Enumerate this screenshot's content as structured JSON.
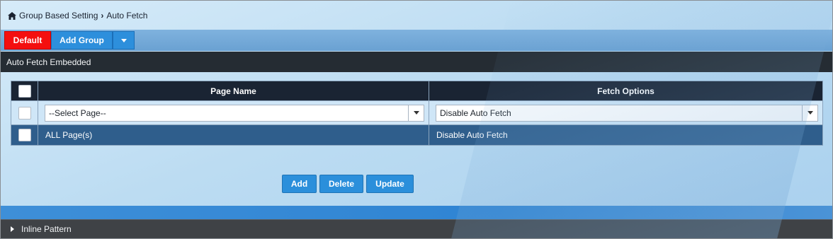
{
  "breadcrumb": {
    "items": [
      "Group Based Setting",
      "Auto Fetch"
    ]
  },
  "toolbar": {
    "default_label": "Default",
    "add_group_label": "Add Group"
  },
  "section": {
    "title": "Auto Fetch Embedded"
  },
  "table": {
    "headers": [
      "Page Name",
      "Fetch Options"
    ],
    "input_row": {
      "page_select": "--Select Page--",
      "fetch_select": "Disable Auto Fetch"
    },
    "rows": [
      {
        "page": "ALL Page(s)",
        "fetch": "Disable Auto Fetch"
      }
    ]
  },
  "actions": {
    "add": "Add",
    "delete": "Delete",
    "update": "Update"
  },
  "collapsed_section": {
    "title": "Inline Pattern"
  },
  "colors": {
    "default_button": "#f40f0f",
    "primary_button": "#2d8fdc",
    "header_dark": "#1a2433",
    "selected_row": "#2f5e8c"
  }
}
